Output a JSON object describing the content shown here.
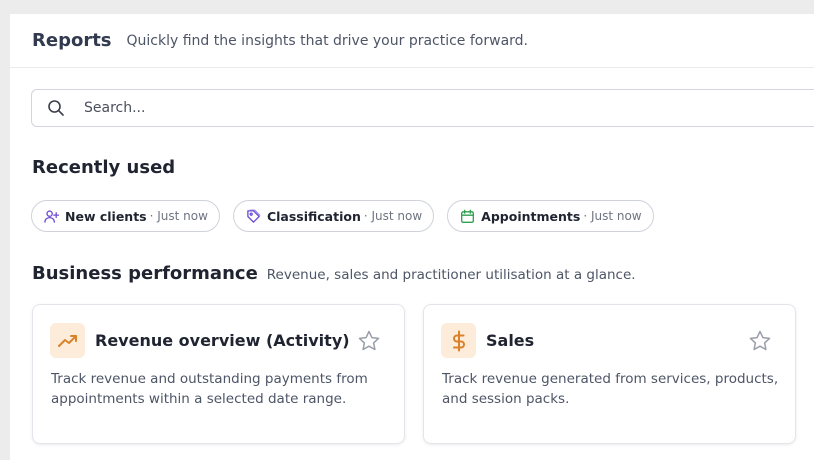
{
  "header": {
    "title": "Reports",
    "subtitle": "Quickly find the insights that drive your practice forward."
  },
  "search": {
    "placeholder": "Search...",
    "icon": "search-icon"
  },
  "recently_used": {
    "title": "Recently used",
    "chips": [
      {
        "label": "New clients",
        "meta": "· Just now",
        "icon": "user-plus-icon",
        "color": "#6c4cd6"
      },
      {
        "label": "Classification",
        "meta": "· Just now",
        "icon": "tag-icon",
        "color": "#6c4cd6"
      },
      {
        "label": "Appointments",
        "meta": "· Just now",
        "icon": "calendar-icon",
        "color": "#2e9e4f"
      }
    ]
  },
  "business_performance": {
    "title": "Business performance",
    "subtitle": "Revenue, sales and practitioner utilisation at a glance.",
    "cards": [
      {
        "title": "Revenue overview (Activity)",
        "description": "Track revenue and outstanding payments from appointments within a selected date range.",
        "icon": "trending-up-icon",
        "favorite_icon": "star-icon"
      },
      {
        "title": "Sales",
        "description": "Track revenue generated from services, products, and session packs.",
        "icon": "dollar-icon",
        "favorite_icon": "star-icon"
      }
    ]
  },
  "colors": {
    "accent_orange": "#d9822b",
    "icon_bg": "#fdecd9",
    "chip_purple": "#6c4cd6",
    "chip_green": "#2e9e4f"
  }
}
